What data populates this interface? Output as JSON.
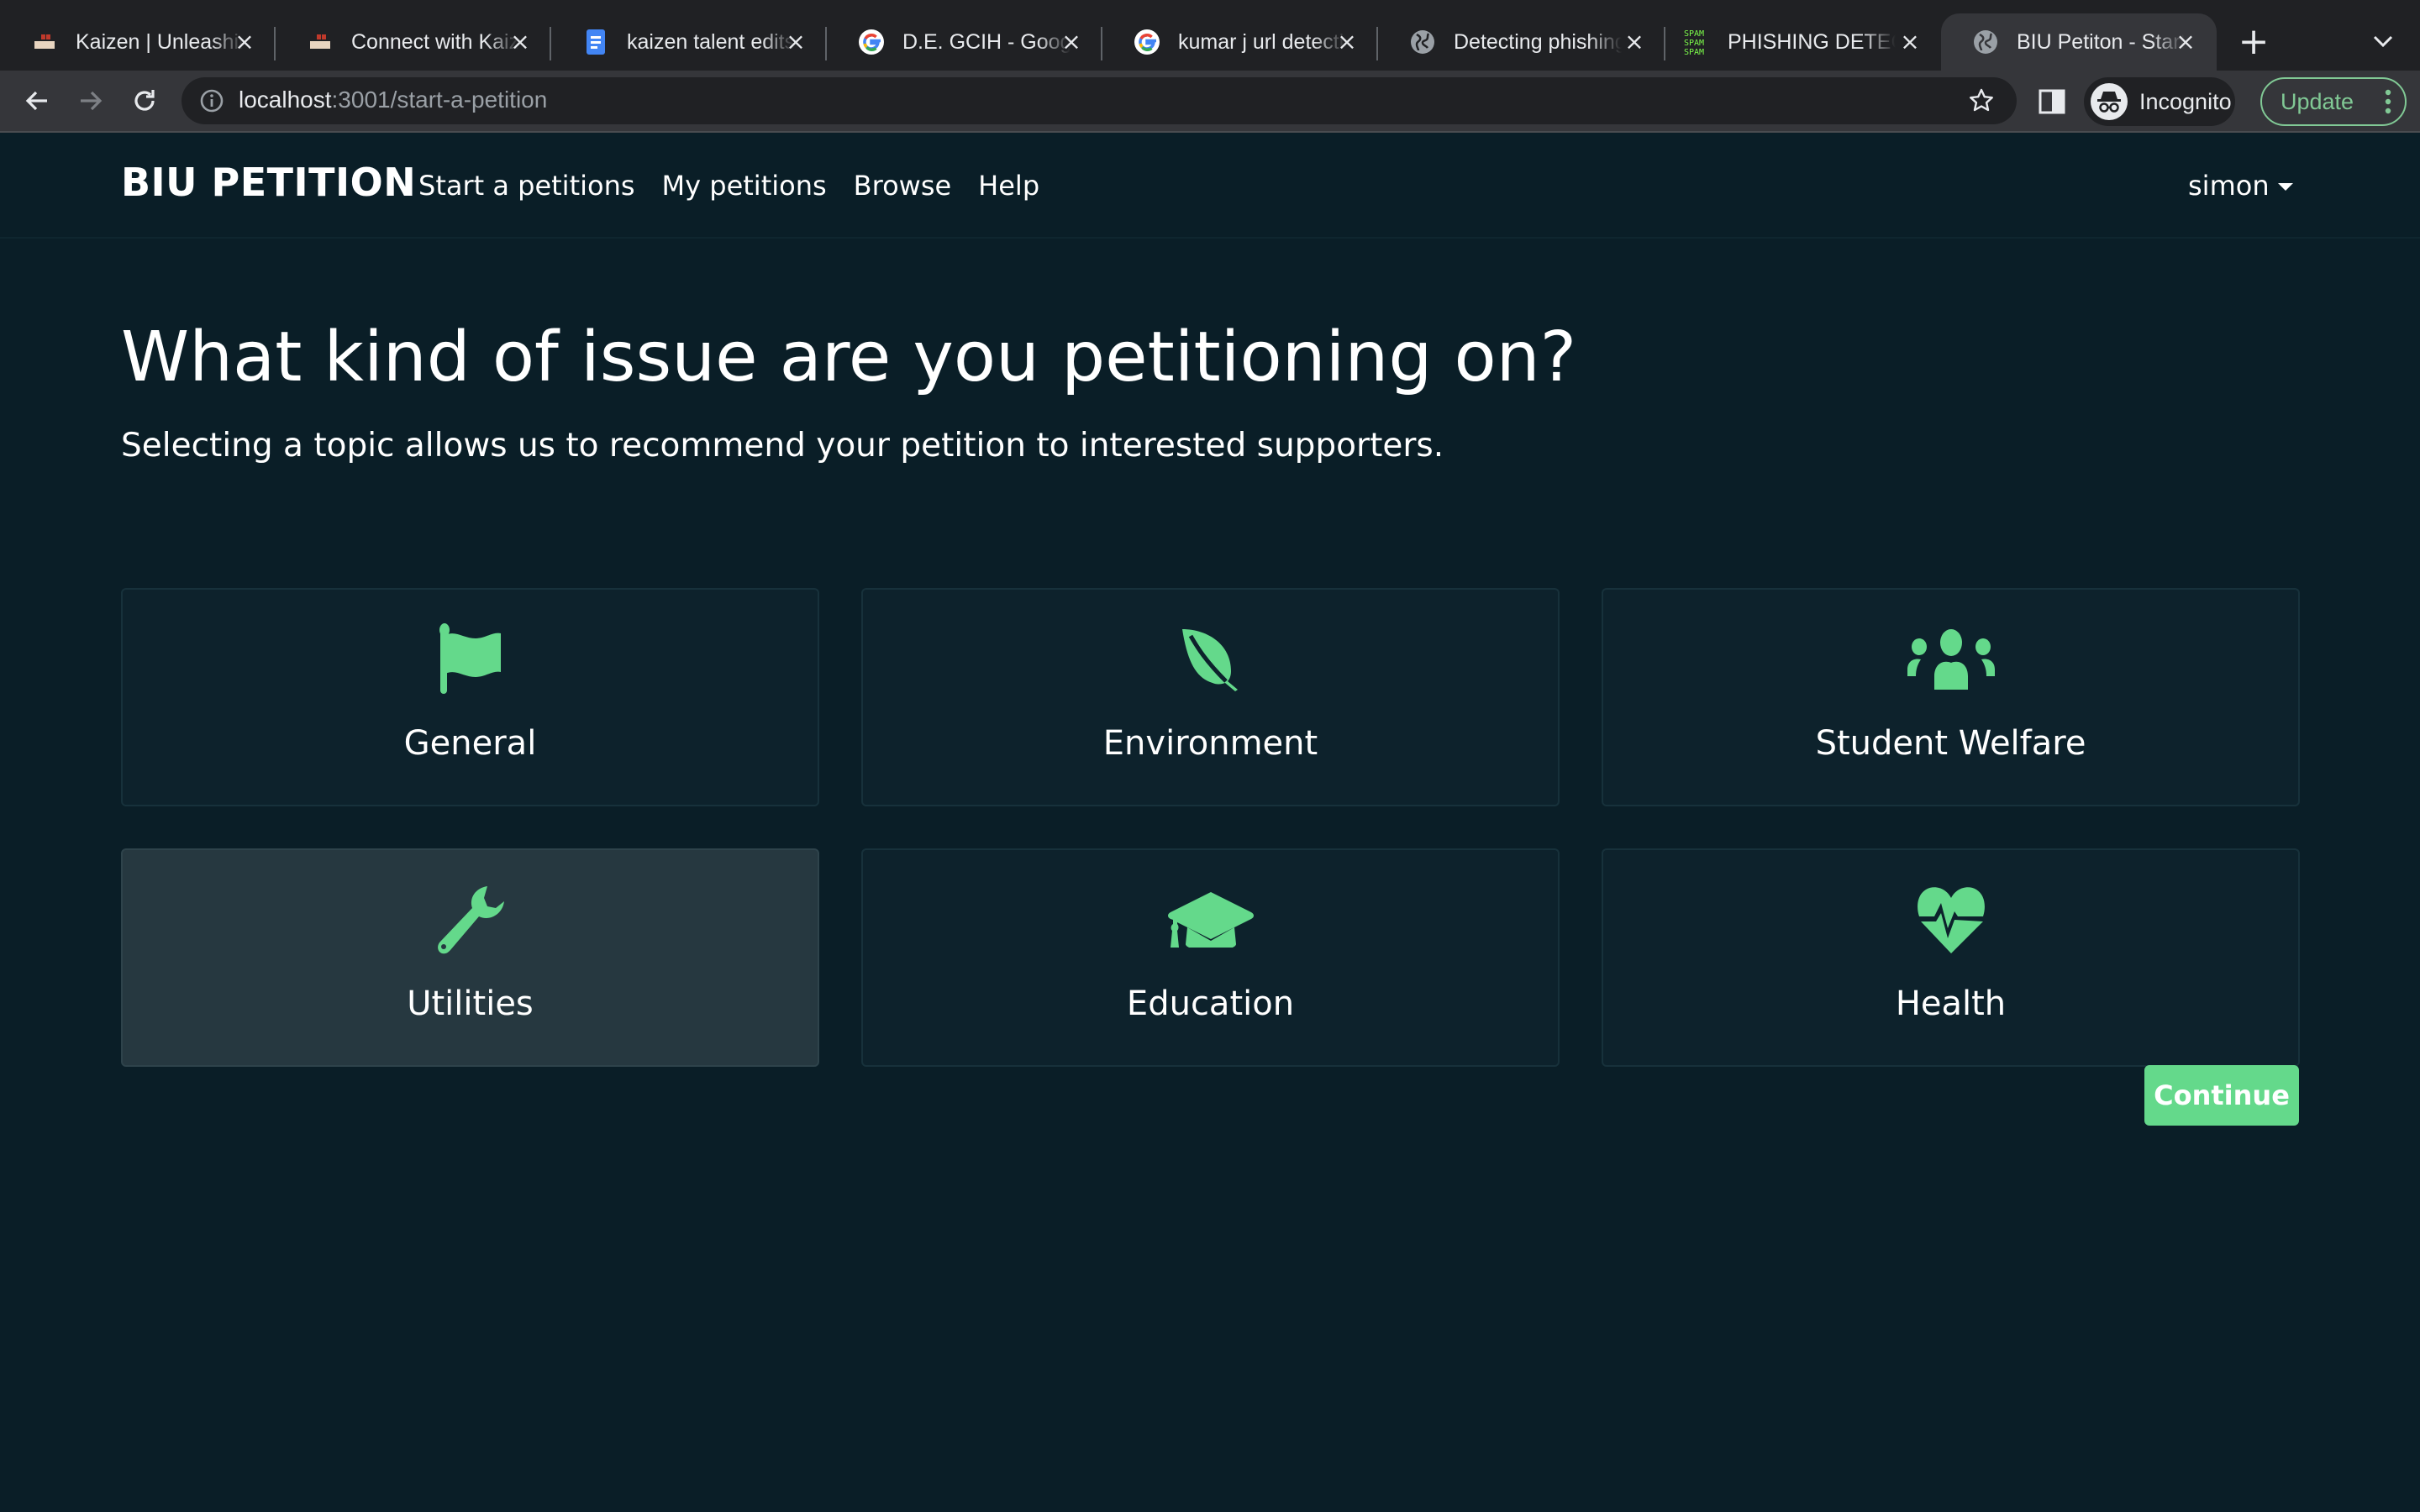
{
  "browser": {
    "tabs": [
      {
        "title": "Kaizen | Unleashing",
        "favicon": "kaizen-logo",
        "active": false
      },
      {
        "title": "Connect with Kaizen",
        "favicon": "kaizen-logo",
        "active": false
      },
      {
        "title": "kaizen talent edits",
        "favicon": "google-docs-icon",
        "active": false
      },
      {
        "title": "D.E. GCIH - Google",
        "favicon": "google-icon",
        "active": false
      },
      {
        "title": "kumar j url detection",
        "favicon": "google-icon",
        "active": false
      },
      {
        "title": "Detecting phishing",
        "favicon": "globe-icon",
        "active": false
      },
      {
        "title": "PHISHING DETECTION",
        "favicon": "spam-icon",
        "active": false
      },
      {
        "title": "BIU Petiton - Start",
        "favicon": "globe-icon",
        "active": true
      }
    ],
    "url_host": "localhost",
    "url_path": ":3001/start-a-petition",
    "profile_label": "Incognito",
    "update_label": "Update"
  },
  "site": {
    "brand": "BIU PETITION",
    "nav": [
      {
        "label": "Start a petitions"
      },
      {
        "label": "My petitions"
      },
      {
        "label": "Browse"
      },
      {
        "label": "Help"
      }
    ],
    "user": "simon"
  },
  "main": {
    "heading": "What kind of issue are you petitioning on?",
    "subheading": "Selecting a topic allows us to recommend your petition to interested supporters.",
    "topics": [
      {
        "label": "General",
        "icon": "flag-icon",
        "selected": false
      },
      {
        "label": "Environment",
        "icon": "leaf-icon",
        "selected": false
      },
      {
        "label": "Student Welfare",
        "icon": "users-icon",
        "selected": false
      },
      {
        "label": "Utilities",
        "icon": "wrench-icon",
        "selected": true
      },
      {
        "label": "Education",
        "icon": "graduation-cap-icon",
        "selected": false
      },
      {
        "label": "Health",
        "icon": "heartbeat-icon",
        "selected": false
      }
    ],
    "continue_label": "Continue"
  },
  "colors": {
    "accent": "#64d98b",
    "background": "#0a1e27",
    "card": "#0d222c",
    "card_selected": "#263840"
  }
}
